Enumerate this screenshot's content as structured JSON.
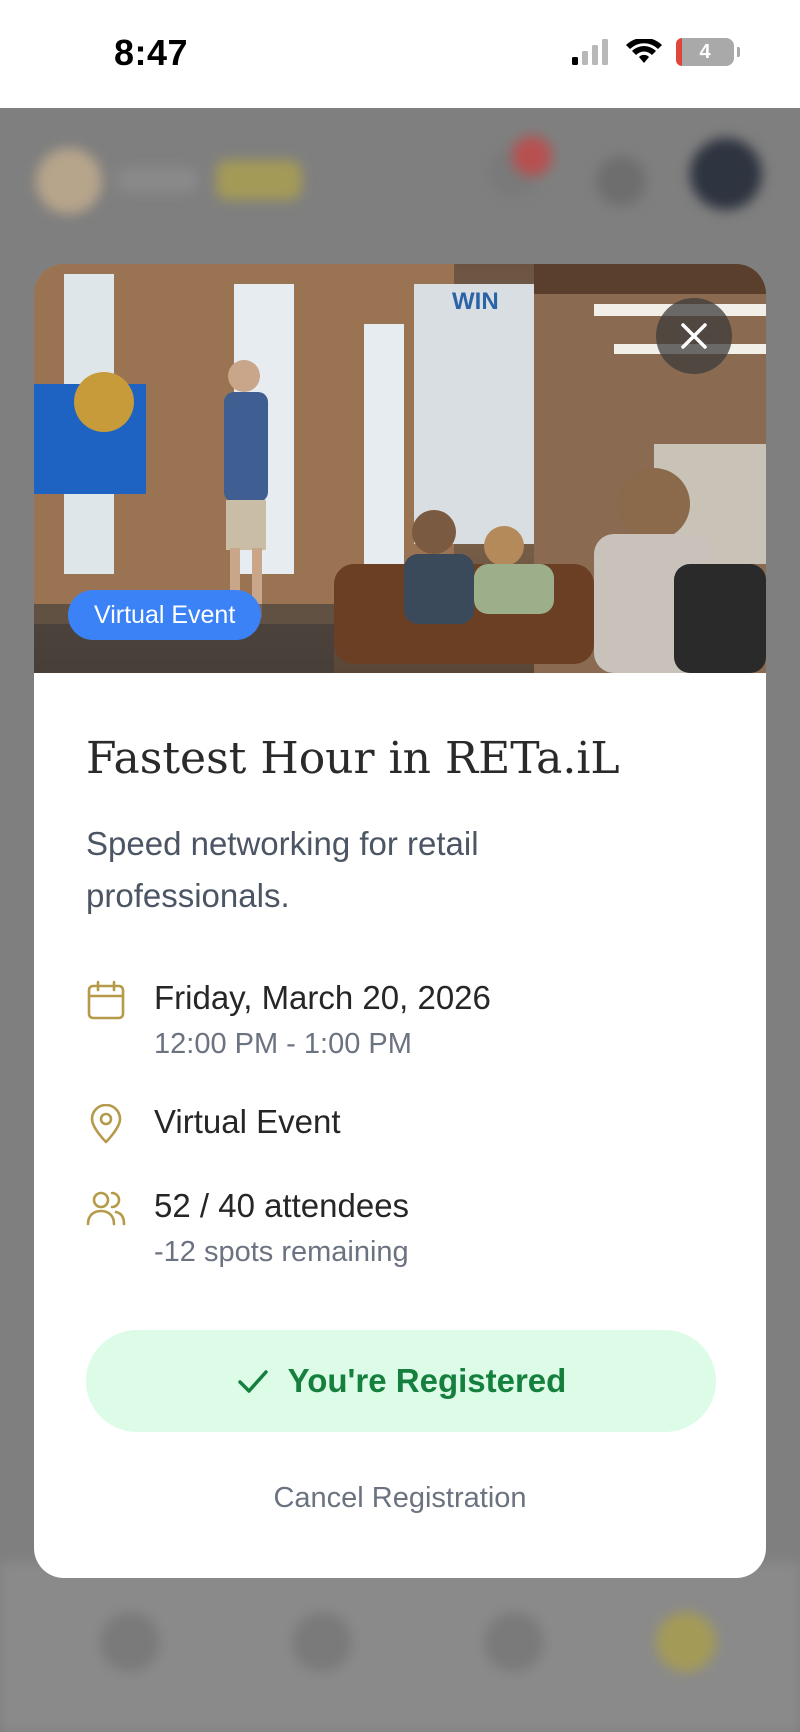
{
  "status_bar": {
    "time": "8:47",
    "battery": "4",
    "icons": [
      "signal-icon",
      "wifi-icon",
      "battery-icon"
    ]
  },
  "modal": {
    "badge": "Virtual Event",
    "title": "Fastest Hour in RETa.iL",
    "description": "Speed networking for retail professionals.",
    "date": "Friday, March 20, 2026",
    "time": "12:00 PM - 1:00 PM",
    "location": "Virtual Event",
    "attendees": "52 / 40 attendees",
    "spots": "-12 spots remaining",
    "registered_label": "You're Registered",
    "cancel_label": "Cancel Registration"
  },
  "colors": {
    "accent_gold": "#b59a4a",
    "badge_blue": "#3b82f6",
    "registered_bg": "#dcfce7",
    "registered_text": "#15803d"
  }
}
